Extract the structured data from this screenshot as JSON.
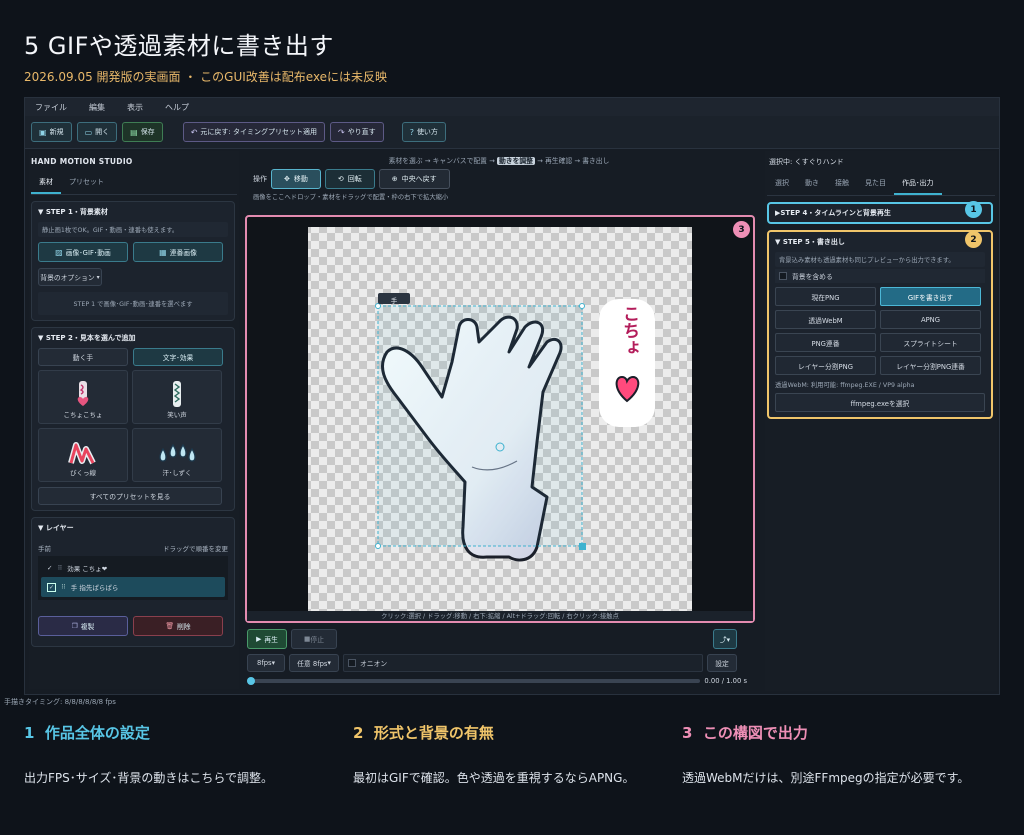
{
  "page": {
    "title": "5 GIFや透過素材に書き出す",
    "subtitle": "2026.09.05 開発版の実画面 ・ このGUI改善は配布exeには未反映"
  },
  "menu": [
    "ファイル",
    "編集",
    "表示",
    "ヘルプ"
  ],
  "toolbar": {
    "new": "新規",
    "open": "開く",
    "save": "保存",
    "undo": "元に戻す: タイミングプリセット適用",
    "redo": "やり直す",
    "help": "使い方"
  },
  "left": {
    "app_name": "HAND MOTION STUDIO",
    "tabs": [
      "素材",
      "プリセット"
    ],
    "step1": {
      "title": "STEP 1・背景素材",
      "hint": "静止画1枚でOK。GIF・動画・連番も使えます。",
      "btn_image": "画像･GIF･動画",
      "btn_seq": "連番画像",
      "bg_options": "背景のオプション",
      "drop_hint": "STEP 1 で画像･GIF･動画･連番を選べます"
    },
    "step2": {
      "title": "STEP 2・見本を選んで追加",
      "tab_hand": "動く手",
      "tab_text": "文字･効果",
      "presets": [
        "こちょこちょ",
        "笑い声",
        "びくっ線",
        "汗･しずく"
      ],
      "all_presets": "すべてのプリセットを見る"
    },
    "layers": {
      "title": "レイヤー",
      "front": "手前",
      "drag_hint": "ドラッグで順番を変更",
      "items": [
        "効果 こちょ❤",
        "手 指先ぱらぱら"
      ],
      "duplicate": "複製",
      "delete": "削除"
    }
  },
  "center": {
    "steps": {
      "a": "素材を選ぶ → キャンバスで配置 → ",
      "cur": "動きを調整",
      "b": " → 再生確認 → 書き出し"
    },
    "ops_label": "操作",
    "move": "移動",
    "rotate": "回転",
    "center": "中央へ戻す",
    "hint": "画像をここへドロップ・素材をドラッグで配置・枠の右下で拡大縮小",
    "hand_label": "手",
    "sticker_text": "こちょ",
    "canvas_hint": "クリック:選択 / ドラッグ:移動 / 右下:拡縮 / Alt+ドラッグ:回転 / 右クリック:接触点",
    "play": "再生",
    "stop": "停止",
    "fps": "8fps",
    "any_fps": "任意 8fps",
    "onion": "オニオン",
    "settings": "設定",
    "time": "0.00 / 1.00 s",
    "progress": 0
  },
  "right": {
    "selected": "選択中: くすぐりハンド",
    "tabs": [
      "選択",
      "動き",
      "接触",
      "見た目",
      "作品･出力"
    ],
    "step4": "STEP 4・タイムラインと背景再生",
    "step5": {
      "title": "STEP 5・書き出し",
      "hint": "背景込み素材も透過素材も同じプレビューから出力できます。",
      "include_bg": "背景を含める",
      "buttons": [
        "現在PNG",
        "GIFを書き出す",
        "透過WebM",
        "APNG",
        "PNG連番",
        "スプライトシート",
        "レイヤー分割PNG",
        "レイヤー分割PNG連番"
      ],
      "ffmpeg_status": "透過WebM: 利用可能: ffmpeg.EXE / VP9 alpha",
      "ffmpeg_btn": "ffmpeg.exeを選択"
    }
  },
  "status": "手描きタイミング: 8/8/8/8/8/8 fps",
  "badges": [
    "1",
    "2",
    "3"
  ],
  "footer": [
    {
      "num": "1",
      "title": "作品全体の設定",
      "text": "出力FPS･サイズ･背景の動きはこちらで調整。",
      "color": "#58c6e6"
    },
    {
      "num": "2",
      "title": "形式と背景の有無",
      "text": "最初はGIFで確認。色や透過を重視するならAPNG。",
      "color": "#f0c56a"
    },
    {
      "num": "3",
      "title": "この構図で出力",
      "text": "透過WebMだけは、別途FFmpegの指定が必要です。",
      "color": "#ee8fb6"
    }
  ],
  "colors": {
    "accent": "#3fb2cf",
    "badge1": "#58c6e6",
    "badge2": "#f0c56a",
    "badge3": "#ee8fb6"
  }
}
